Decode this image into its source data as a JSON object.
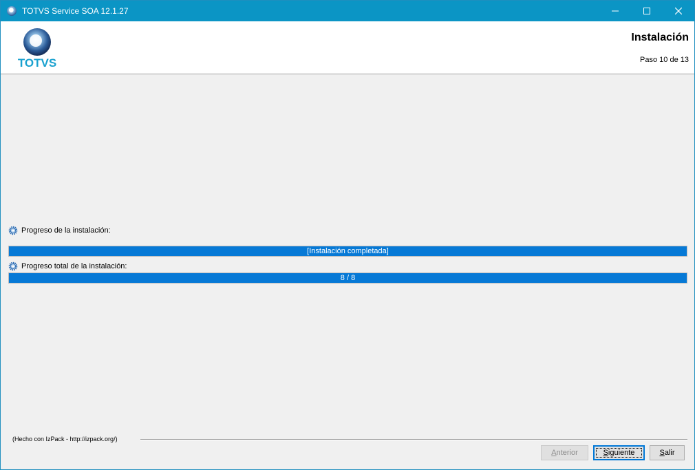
{
  "window": {
    "title": "TOTVS Service SOA 12.1.27",
    "titlebar_color": "#0b95c5"
  },
  "header": {
    "logo_text": "TOTVS",
    "title": "Instalación",
    "step": "Paso 10 de 13"
  },
  "progress": {
    "install_label": "Progreso de la instalación:",
    "install_status": "[Instalación completada]",
    "install_fraction": 1.0,
    "total_label": "Progreso total de la instalación:",
    "total_status": "8 / 8",
    "total_fraction": 1.0,
    "bar_color": "#0679d6"
  },
  "footer": {
    "credit": "(Hecho con IzPack - http://izpack.org/)"
  },
  "buttons": {
    "anterior_mnemonic": "A",
    "anterior_rest": "nterior",
    "siguiente_mnemonic": "S",
    "siguiente_rest": "iguiente",
    "salir_mnemonic": "S",
    "salir_rest": "alir"
  },
  "icons": {
    "app": "totvs-logo-icon",
    "minimize": "minimize-icon",
    "maximize": "maximize-icon",
    "close": "close-icon",
    "gear": "gear-icon"
  }
}
